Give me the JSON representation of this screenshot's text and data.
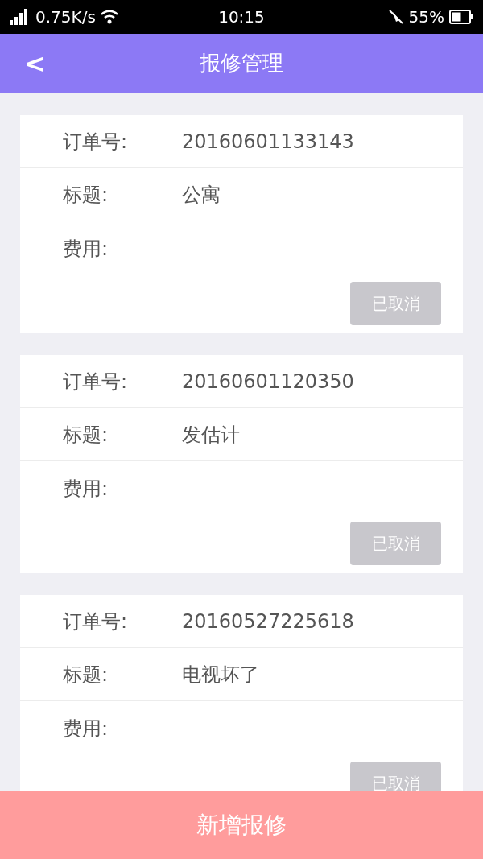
{
  "status_bar": {
    "speed": "0.75K/s",
    "time": "10:15",
    "battery": "55%"
  },
  "header": {
    "back": "<",
    "title": "报修管理"
  },
  "orders": [
    {
      "order_label": "订单号:",
      "order_no": "20160601133143",
      "title_label": "标题:",
      "title": "公寓",
      "fee_label": "费用:",
      "status": "已取消",
      "disabled": true
    },
    {
      "order_label": "订单号:",
      "order_no": "20160601120350",
      "title_label": "标题:",
      "title": "发估计",
      "fee_label": "费用:",
      "status": "已取消",
      "disabled": true
    },
    {
      "order_label": "订单号:",
      "order_no": "20160527225618",
      "title_label": "标题:",
      "title": "电视坏了",
      "fee_label": "费用:",
      "status": "已取消",
      "disabled": true
    }
  ],
  "add_button": "新增报修"
}
